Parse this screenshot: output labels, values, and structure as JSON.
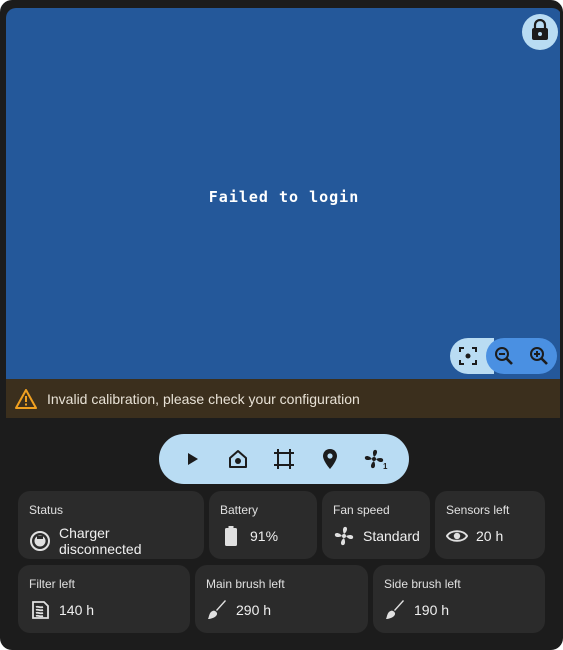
{
  "map": {
    "message": "Failed to login"
  },
  "warning": {
    "text": "Invalid calibration, please check your configuration",
    "color": "#f0a020"
  },
  "controls": {
    "items": [
      "play-icon",
      "home-icon",
      "zone-select-icon",
      "location-pin-icon",
      "fan-icon"
    ]
  },
  "tiles": [
    {
      "label": "Status",
      "value": "Charger disconnected",
      "icon": "robot-vacuum-icon"
    },
    {
      "label": "Battery",
      "value": "91%",
      "icon": "battery-icon"
    },
    {
      "label": "Fan speed",
      "value": "Standard",
      "icon": "fan-icon"
    },
    {
      "label": "Sensors left",
      "value": "20 h",
      "icon": "eye-icon"
    },
    {
      "label": "Filter left",
      "value": "140 h",
      "icon": "filter-icon"
    },
    {
      "label": "Main brush left",
      "value": "290 h",
      "icon": "brush-icon"
    },
    {
      "label": "Side brush left",
      "value": "190 h",
      "icon": "brush-icon"
    }
  ],
  "colors": {
    "accent": "#b9dcf3",
    "zoom": "#4a90e2",
    "map_bg": "#24589a",
    "card_bg": "#1c1c1c",
    "tile_bg": "#2b2b2b"
  }
}
